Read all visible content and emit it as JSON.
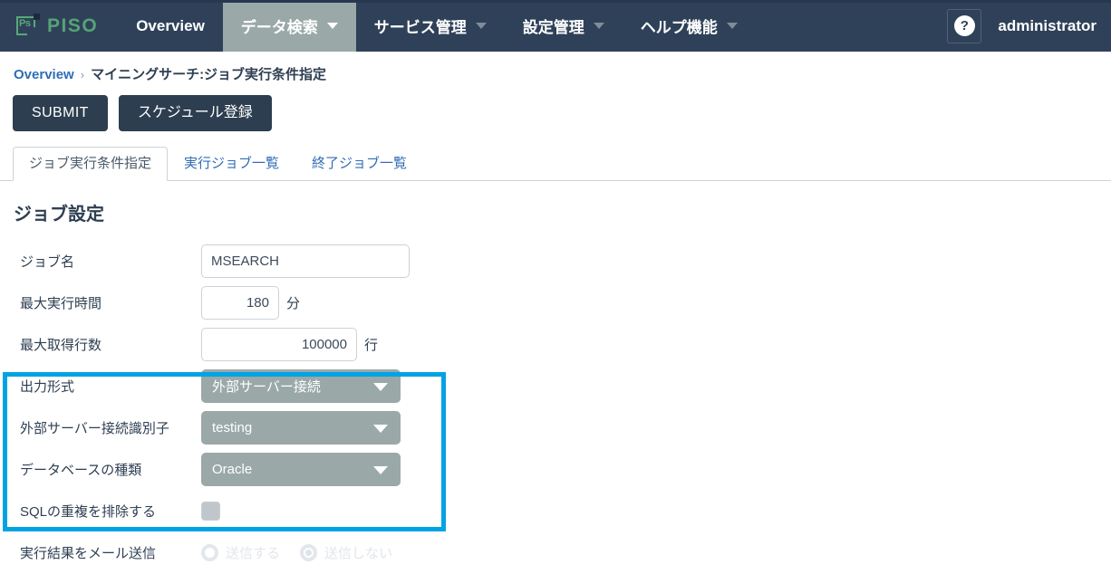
{
  "colors": {
    "navbar_bg": "#2f4159",
    "nav_active_bg": "#9aa8a8",
    "brand_green": "#56a277",
    "link_blue": "#2f6cb5",
    "button_navy": "#2d3e50",
    "highlight_cyan": "#00a3e3",
    "disabled_gray": "#9aa8a8"
  },
  "navbar": {
    "brand": {
      "mark_text": "Ps",
      "name": "PISO"
    },
    "items": [
      {
        "label": "Overview",
        "has_caret": false,
        "active": false
      },
      {
        "label": "データ検索",
        "has_caret": true,
        "active": true
      },
      {
        "label": "サービス管理",
        "has_caret": true,
        "active": false
      },
      {
        "label": "設定管理",
        "has_caret": true,
        "active": false
      },
      {
        "label": "ヘルプ機能",
        "has_caret": true,
        "active": false
      }
    ],
    "help_glyph": "?",
    "username": "administrator"
  },
  "breadcrumb": {
    "root": "Overview",
    "separator": "›",
    "current": "マイニングサーチ:ジョブ実行条件指定"
  },
  "actions": {
    "submit_label": "SUBMIT",
    "schedule_label": "スケジュール登録"
  },
  "tabs": [
    {
      "label": "ジョブ実行条件指定",
      "active": true
    },
    {
      "label": "実行ジョブ一覧",
      "active": false
    },
    {
      "label": "終了ジョブ一覧",
      "active": false
    }
  ],
  "form": {
    "section_title": "ジョブ設定",
    "job_name": {
      "label": "ジョブ名",
      "value": "MSEARCH",
      "placeholder": ""
    },
    "max_time": {
      "label": "最大実行時間",
      "value": "180",
      "unit": "分"
    },
    "max_rows": {
      "label": "最大取得行数",
      "value": "100000",
      "unit": "行"
    },
    "output_format": {
      "label": "出力形式",
      "value": "外部サーバー接続",
      "disabled": true,
      "options": [
        "外部サーバー接続"
      ]
    },
    "server_id": {
      "label": "外部サーバー接続識別子",
      "value": "testing",
      "disabled": true,
      "options": [
        "testing"
      ]
    },
    "database_type": {
      "label": "データベースの種類",
      "value": "Oracle",
      "disabled": true,
      "options": [
        "Oracle"
      ]
    },
    "dedupe_sql": {
      "label": "SQLの重複を排除する",
      "checked": false,
      "disabled": true
    },
    "mail_result": {
      "label": "実行結果をメール送信",
      "options": [
        {
          "label": "送信する",
          "selected": false
        },
        {
          "label": "送信しない",
          "selected": true
        }
      ],
      "disabled": true
    }
  }
}
